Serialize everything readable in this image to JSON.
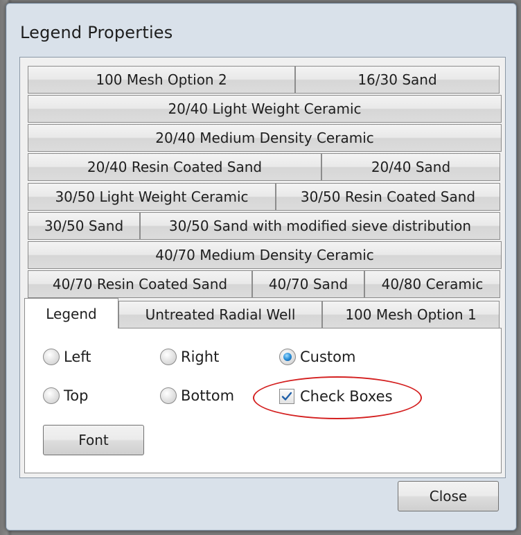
{
  "dialog": {
    "title": "Legend Properties"
  },
  "tabs": {
    "rows": [
      [
        "100 Mesh Option 2",
        "16/30 Sand"
      ],
      [
        "20/40 Light Weight Ceramic"
      ],
      [
        "20/40 Medium Density Ceramic"
      ],
      [
        "20/40 Resin Coated Sand",
        "20/40 Sand"
      ],
      [
        "30/50 Light Weight Ceramic",
        "30/50 Resin Coated Sand"
      ],
      [
        "30/50 Sand",
        "30/50 Sand with modified sieve distribution"
      ],
      [
        "40/70 Medium Density Ceramic"
      ],
      [
        "40/70 Resin Coated Sand",
        "40/70 Sand",
        "40/80 Ceramic"
      ],
      [
        "Legend",
        "Untreated Radial Well",
        "100 Mesh Option 1"
      ]
    ],
    "active": "Legend"
  },
  "legend_panel": {
    "position_options": {
      "left": "Left",
      "right": "Right",
      "custom": "Custom",
      "top": "Top",
      "bottom": "Bottom"
    },
    "selected_position": "Custom",
    "check_boxes": {
      "label": "Check Boxes",
      "checked": true
    },
    "font_button": "Font"
  },
  "footer": {
    "close_button": "Close"
  },
  "colors": {
    "annotation_circle": "#d42020",
    "radio_selected": "#2a8fd8",
    "check_mark": "#1f5fa8"
  }
}
